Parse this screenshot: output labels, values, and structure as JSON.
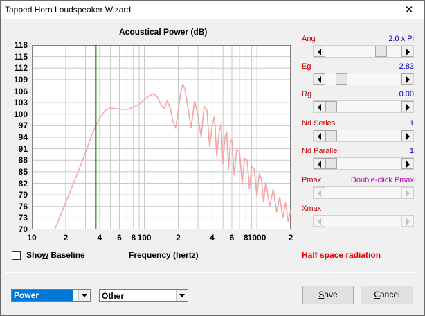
{
  "window": {
    "title": "Tapped Horn Loudspeaker Wizard",
    "close_glyph": "✕"
  },
  "chart": {
    "title": "Acoustical Power (dB)",
    "xlabel": "Frequency (hertz)",
    "y_ticks": [
      "118",
      "115",
      "112",
      "109",
      "106",
      "103",
      "100",
      "97",
      "94",
      "91",
      "88",
      "85",
      "82",
      "79",
      "76",
      "73",
      "70"
    ],
    "x_ticks": [
      {
        "label": "10",
        "f": 10
      },
      {
        "label": "2",
        "f": 20
      },
      {
        "label": "4",
        "f": 40
      },
      {
        "label": "6",
        "f": 60
      },
      {
        "label": "8",
        "f": 80
      },
      {
        "label": "100",
        "f": 100
      },
      {
        "label": "2",
        "f": 200
      },
      {
        "label": "4",
        "f": 400
      },
      {
        "label": "6",
        "f": 600
      },
      {
        "label": "8",
        "f": 800
      },
      {
        "label": "1000",
        "f": 1000
      },
      {
        "label": "2",
        "f": 2000
      }
    ]
  },
  "chart_data": {
    "type": "line",
    "title": "Acoustical Power (dB)",
    "xlabel": "Frequency (hertz)",
    "ylabel": "",
    "xscale": "log",
    "xlim": [
      10,
      2000
    ],
    "ylim": [
      70,
      118
    ],
    "grid": true,
    "marker_frequency": 37,
    "line_color": "#f4a6a6",
    "marker_color": "#007000",
    "series": [
      {
        "x": [
          16,
          20,
          25,
          30,
          34,
          37,
          40,
          45,
          50,
          60,
          70,
          80,
          90,
          100,
          110,
          120,
          130,
          140,
          150,
          160,
          170,
          180,
          190,
          200,
          210,
          220,
          230,
          240,
          260,
          280,
          300,
          320,
          340,
          360,
          380,
          400,
          420,
          440,
          460,
          480,
          500,
          520,
          540,
          560,
          580,
          600,
          630,
          660,
          700,
          740,
          780,
          820,
          860,
          900,
          950,
          1000,
          1050,
          1100,
          1150,
          1200,
          1300,
          1400,
          1500,
          1600,
          1700,
          1800,
          1900,
          2000
        ],
        "y": [
          70,
          77,
          84,
          90,
          94.5,
          97,
          99,
          101,
          101.6,
          101.3,
          101.2,
          101.8,
          102.6,
          103.8,
          104.8,
          105.3,
          104.6,
          102.5,
          101.5,
          103.5,
          101.5,
          98,
          96.5,
          101,
          105.5,
          107.8,
          106.5,
          103,
          96.5,
          103.5,
          99.5,
          94,
          102,
          101,
          91.5,
          97,
          99.5,
          89,
          95,
          97.5,
          87,
          94,
          95.5,
          85.5,
          92.5,
          93.5,
          84,
          90.5,
          90.5,
          82,
          88.5,
          88,
          80.5,
          86.5,
          85.5,
          78.5,
          84.5,
          83,
          77,
          82.5,
          76,
          80.5,
          74.5,
          78.5,
          73,
          77,
          72,
          75
        ]
      }
    ]
  },
  "params": [
    {
      "label": "Ang",
      "value": "2.0 x Pi",
      "value_color": "#0000c0",
      "position": 0.77,
      "disabled": false
    },
    {
      "label": "Eg",
      "value": "2.83",
      "value_color": "#0000c0",
      "position": 0.16,
      "disabled": false
    },
    {
      "label": "Rg",
      "value": "0.00",
      "value_color": "#0000c0",
      "position": 0.0,
      "disabled": false
    },
    {
      "label": "Nd  Series",
      "value": "1",
      "value_color": "#0000c0",
      "position": 0.0,
      "disabled": false
    },
    {
      "label": "Nd  Parallel",
      "value": "1",
      "value_color": "#0000c0",
      "position": 0.0,
      "disabled": false
    },
    {
      "label": "Pmax",
      "value": "Double-click Pmax",
      "value_color": "#c000c0",
      "position": null,
      "disabled": true
    },
    {
      "label": "Xmax",
      "value": "",
      "value_color": "#0000c0",
      "position": null,
      "disabled": true
    }
  ],
  "show_baseline": {
    "label": "Show Baseline",
    "checked": false
  },
  "radiation_label": "Half space radiation",
  "combo_power": {
    "value": "Power"
  },
  "combo_other": {
    "value": "Other"
  },
  "buttons": {
    "save": "Save",
    "cancel": "Cancel"
  }
}
